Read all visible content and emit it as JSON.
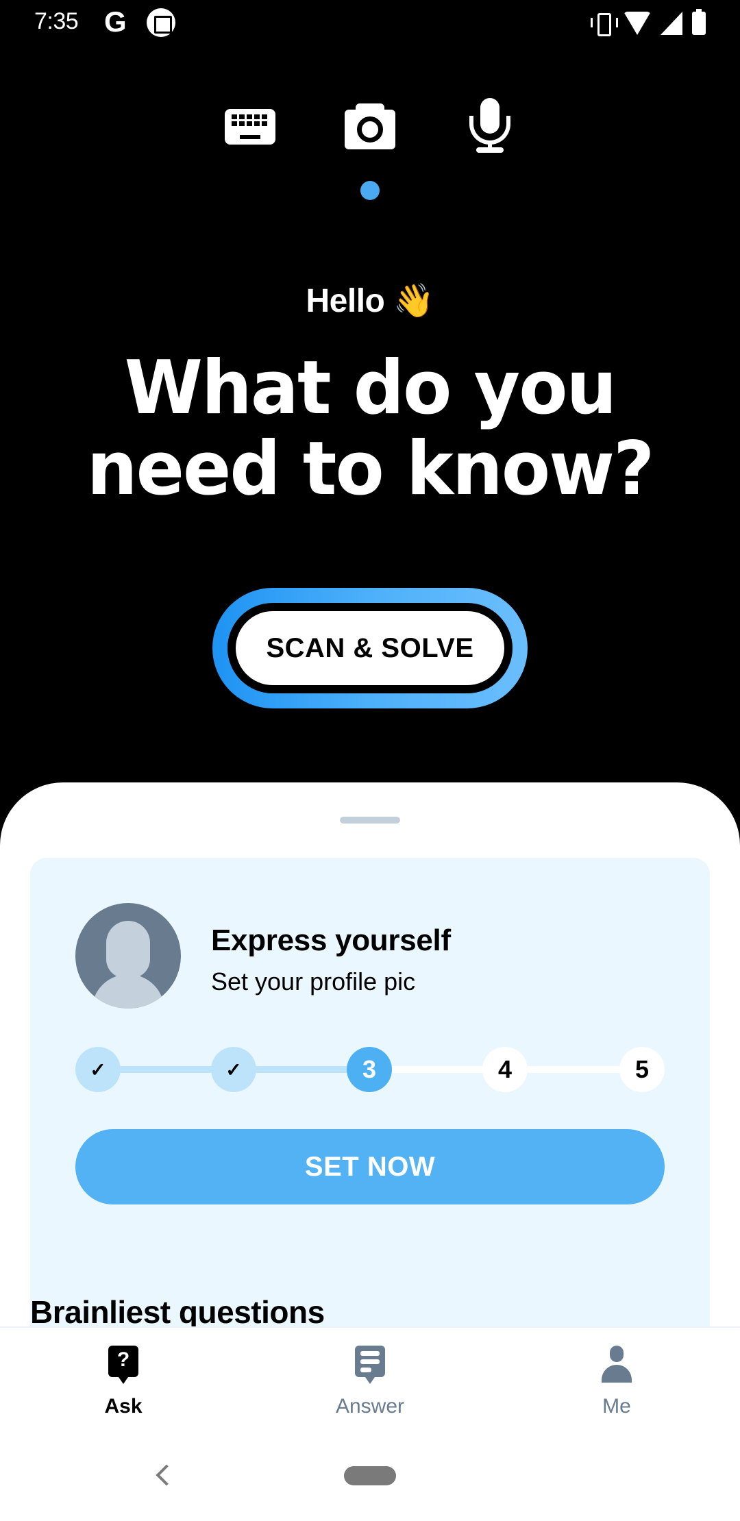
{
  "status_bar": {
    "time": "7:35",
    "notification_icons": [
      "google-g-icon",
      "screenshot-app-icon"
    ],
    "system_icons": [
      "vibrate-icon",
      "wifi-icon",
      "cell-signal-icon",
      "battery-charging-icon"
    ]
  },
  "input_modes": {
    "items": [
      {
        "name": "keyboard",
        "icon": "keyboard-icon",
        "selected": false
      },
      {
        "name": "camera",
        "icon": "camera-icon",
        "selected": true
      },
      {
        "name": "microphone",
        "icon": "microphone-icon",
        "selected": false
      }
    ]
  },
  "hero": {
    "greeting": "Hello 👋",
    "title_line1": "What do you",
    "title_line2": "need to know?"
  },
  "scan_button": {
    "label": "SCAN & SOLVE"
  },
  "profile_card": {
    "title": "Express yourself",
    "subtitle": "Set your profile pic",
    "steps": [
      {
        "label": "✓",
        "state": "done"
      },
      {
        "label": "✓",
        "state": "done"
      },
      {
        "label": "3",
        "state": "current"
      },
      {
        "label": "4",
        "state": "todo"
      },
      {
        "label": "5",
        "state": "todo"
      }
    ],
    "progress_current_step": 3,
    "progress_total_steps": 5,
    "cta_label": "SET NOW"
  },
  "section": {
    "title": "Brainliest questions"
  },
  "bottom_nav": {
    "items": [
      {
        "label": "Ask",
        "icon": "ask-question-icon",
        "active": true
      },
      {
        "label": "Answer",
        "icon": "answer-icon",
        "active": false
      },
      {
        "label": "Me",
        "icon": "profile-icon",
        "active": false
      }
    ]
  },
  "colors": {
    "accent_blue": "#52b2f3",
    "scan_gradient_start": "#1e93f3",
    "scan_gradient_end": "#6bbefc",
    "card_background": "#ebf7fe",
    "step_done": "#bde3fb",
    "inactive_nav": "#687b8f"
  }
}
